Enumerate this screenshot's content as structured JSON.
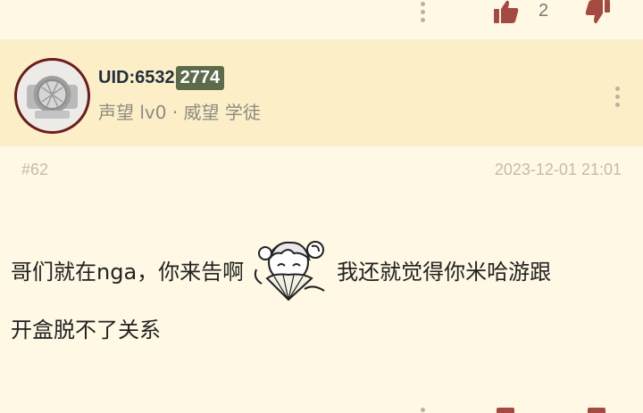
{
  "top_bar": {
    "more_icon": "vertical-dots-icon",
    "like_icon": "thumb-up-icon",
    "like_count": "2",
    "dislike_icon": "thumb-down-icon"
  },
  "user": {
    "uid_prefix": "UID:6532",
    "uid_highlight": "2774",
    "reputation": "声望 lv0 · 威望 学徒",
    "avatar_icon": "default-avatar-icon",
    "more_icon": "vertical-dots-icon"
  },
  "post": {
    "number": "#62",
    "date": "2023-12-01 21:01",
    "text_part1": "哥们就在nga，你来告啊",
    "sticker": "anime-girl-fan-sticker",
    "text_part2": "我还就觉得你米哈游跟",
    "text_line2": "开盒脱不了关系"
  },
  "colors": {
    "page_bg": "#fef8e4",
    "header_bg": "#fcefc7",
    "avatar_ring": "#6b1d1d",
    "uid_highlight_bg": "#5d6b4a",
    "icon_color": "#a44a40"
  }
}
